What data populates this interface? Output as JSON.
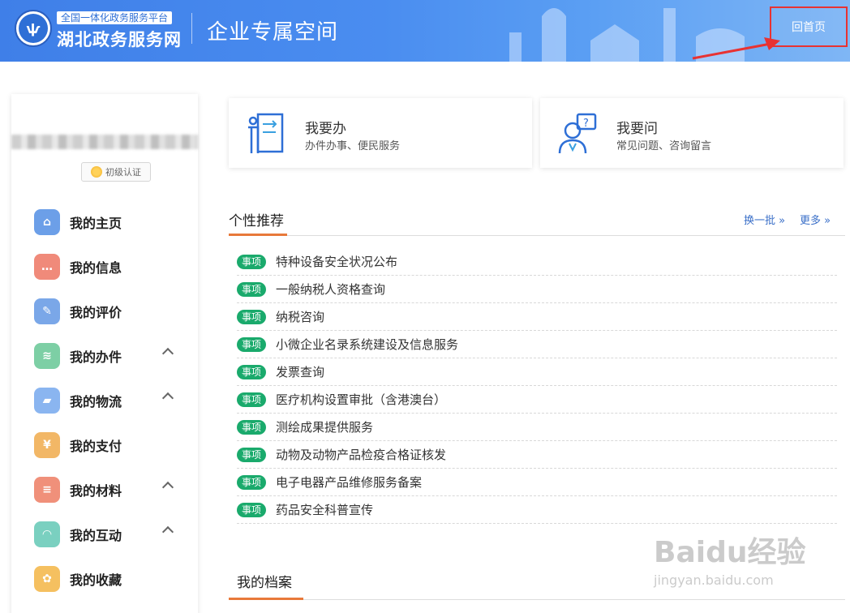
{
  "header": {
    "platform_tag": "全国一体化政务服务平台",
    "site_name": "湖北政务服务网",
    "space_title": "企业专属空间",
    "home_button": "回首页"
  },
  "sidebar": {
    "cert_label": "初级认证",
    "menu": [
      {
        "label": "我的主页",
        "icon": "home-icon",
        "color": "#6c9fe8",
        "expandable": false
      },
      {
        "label": "我的信息",
        "icon": "message-icon",
        "color": "#f08a7a",
        "expandable": false
      },
      {
        "label": "我的评价",
        "icon": "edit-icon",
        "color": "#7aa7e8",
        "expandable": false
      },
      {
        "label": "我的办件",
        "icon": "layers-icon",
        "color": "#7dcfa5",
        "expandable": true
      },
      {
        "label": "我的物流",
        "icon": "truck-icon",
        "color": "#8ab5f0",
        "expandable": true
      },
      {
        "label": "我的支付",
        "icon": "yen-icon",
        "color": "#f2b766",
        "expandable": false
      },
      {
        "label": "我的材料",
        "icon": "document-icon",
        "color": "#f0907a",
        "expandable": true
      },
      {
        "label": "我的互动",
        "icon": "chat-icon",
        "color": "#7ad0c0",
        "expandable": true
      },
      {
        "label": "我的收藏",
        "icon": "star-icon",
        "color": "#f5c060",
        "expandable": false
      }
    ]
  },
  "cards": {
    "do": {
      "title": "我要办",
      "subtitle": "办件办事、便民服务"
    },
    "ask": {
      "title": "我要问",
      "subtitle": "常见问题、咨询留言"
    }
  },
  "recommend": {
    "title": "个性推荐",
    "refresh_label": "换一批 »",
    "more_label": "更多 »",
    "tag": "事项",
    "items": [
      "特种设备安全状况公布",
      "一般纳税人资格查询",
      "纳税咨询",
      "小微企业名录系统建设及信息服务",
      "发票查询",
      "医疗机构设置审批（含港澳台）",
      "测绘成果提供服务",
      "动物及动物产品检疫合格证核发",
      "电子电器产品维修服务备案",
      "药品安全科普宣传"
    ]
  },
  "archive": {
    "title": "我的档案"
  },
  "watermark": {
    "main": "Baidu经验",
    "sub": "jingyan.baidu.com"
  },
  "colors": {
    "accent": "#e8793a",
    "tag_green": "#1aaa6c",
    "header_blue": "#3f7fe8",
    "highlight_red": "#e83232"
  }
}
